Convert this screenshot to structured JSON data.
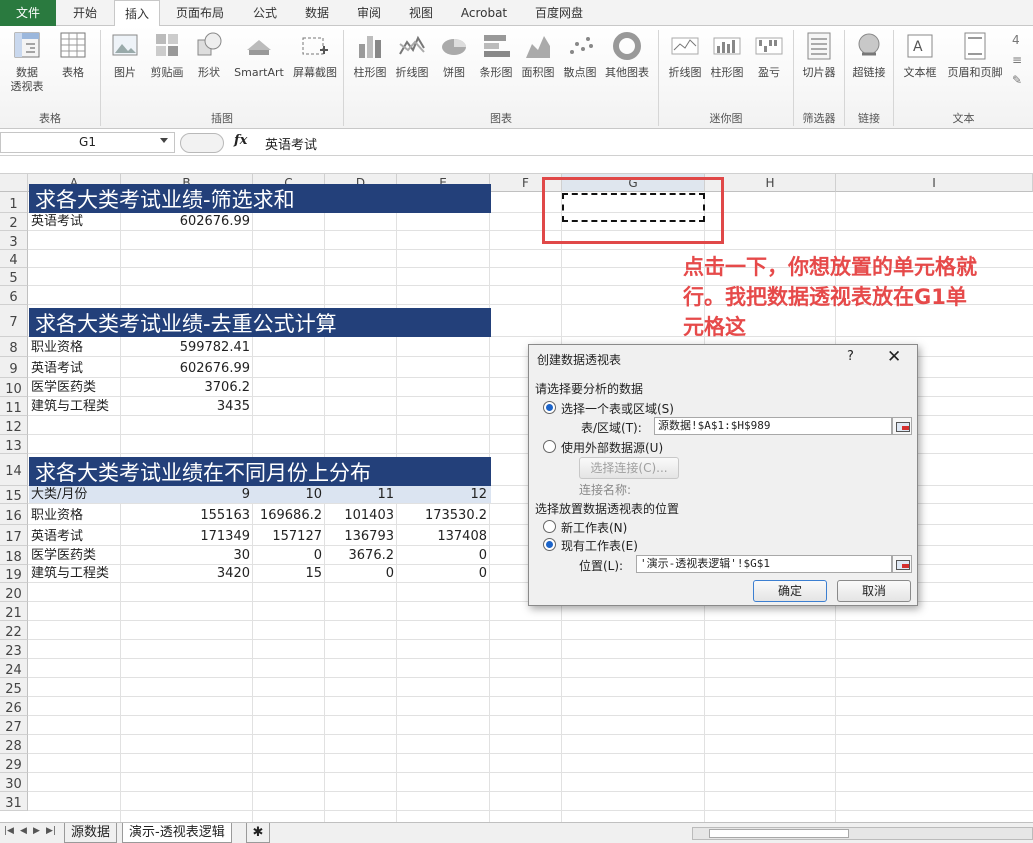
{
  "ribbon_tabs": [
    "文件",
    "开始",
    "插入",
    "页面布局",
    "公式",
    "数据",
    "审阅",
    "视图",
    "Acrobat",
    "百度网盘"
  ],
  "ribbon": {
    "buttons": [
      {
        "label": "数据",
        "label2": "透视表",
        "icon": "pivot-table-icon"
      },
      {
        "label": "表格",
        "label2": "",
        "icon": "table-icon"
      },
      {
        "label": "图片",
        "label2": "",
        "icon": "picture-icon"
      },
      {
        "label": "剪贴画",
        "label2": "",
        "icon": "clipart-icon"
      },
      {
        "label": "形状",
        "label2": "",
        "icon": "shapes-icon"
      },
      {
        "label": "SmartArt",
        "label2": "",
        "icon": "smartart-icon"
      },
      {
        "label": "屏幕截图",
        "label2": "",
        "icon": "screenshot-icon"
      },
      {
        "label": "柱形图",
        "label2": "",
        "icon": "column-chart-icon"
      },
      {
        "label": "折线图",
        "label2": "",
        "icon": "line-chart-icon"
      },
      {
        "label": "饼图",
        "label2": "",
        "icon": "pie-chart-icon"
      },
      {
        "label": "条形图",
        "label2": "",
        "icon": "bar-chart-icon"
      },
      {
        "label": "面积图",
        "label2": "",
        "icon": "area-chart-icon"
      },
      {
        "label": "散点图",
        "label2": "",
        "icon": "scatter-chart-icon"
      },
      {
        "label": "其他图表",
        "label2": "",
        "icon": "other-chart-icon"
      },
      {
        "label": "折线图",
        "label2": "",
        "icon": "sparkline-line-icon"
      },
      {
        "label": "柱形图",
        "label2": "",
        "icon": "sparkline-column-icon"
      },
      {
        "label": "盈亏",
        "label2": "",
        "icon": "sparkline-winloss-icon"
      },
      {
        "label": "切片器",
        "label2": "",
        "icon": "slicer-icon"
      },
      {
        "label": "超链接",
        "label2": "",
        "icon": "hyperlink-icon"
      },
      {
        "label": "文本框",
        "label2": "",
        "icon": "textbox-icon"
      },
      {
        "label": "页眉和页脚",
        "label2": "",
        "icon": "header-footer-icon"
      }
    ],
    "groups": [
      "表格",
      "插图",
      "图表",
      "迷你图",
      "筛选器",
      "链接",
      "文本"
    ]
  },
  "formula_bar": {
    "name_box": "G1",
    "fx": "fx",
    "content": "英语考试"
  },
  "columns": [
    "A",
    "B",
    "C",
    "D",
    "E",
    "F",
    "G",
    "H",
    "I"
  ],
  "rows": [
    "1",
    "2",
    "3",
    "4",
    "5",
    "6",
    "7",
    "8",
    "9",
    "10",
    "11",
    "12",
    "13",
    "14",
    "15",
    "16",
    "17",
    "18",
    "19",
    "20",
    "21",
    "22",
    "23",
    "24",
    "25",
    "26",
    "27",
    "28",
    "29",
    "30",
    "31"
  ],
  "sheet": {
    "section1": {
      "title": "求各大类考试业绩-筛选求和",
      "label": "英语考试",
      "value": "602676.99"
    },
    "section2": {
      "title": "求各大类考试业绩-去重公式计算",
      "rows": [
        {
          "label": "职业资格",
          "value": "599782.41"
        },
        {
          "label": "英语考试",
          "value": "602676.99"
        },
        {
          "label": "医学医药类",
          "value": "3706.2"
        },
        {
          "label": "建筑与工程类",
          "value": "3435"
        }
      ]
    },
    "section3": {
      "title": "求各大类考试业绩在不同月份上分布",
      "header": [
        "大类/月份",
        "9",
        "10",
        "11",
        "12"
      ],
      "rows": [
        [
          "职业资格",
          "155163",
          "169686.2",
          "101403",
          "173530.2"
        ],
        [
          "英语考试",
          "171349",
          "157127",
          "136793",
          "137408"
        ],
        [
          "医学医药类",
          "30",
          "0",
          "3676.2",
          "0"
        ],
        [
          "建筑与工程类",
          "3420",
          "15",
          "0",
          "0"
        ]
      ]
    }
  },
  "annotation": "点击一下，你想放置的单元格就行。我把数据透视表放在G1单元格这",
  "dialog": {
    "title": "创建数据透视表",
    "help": "?",
    "close": "✕",
    "section_analyze": "请选择要分析的数据",
    "opt_range": "选择一个表或区域(S)",
    "range_label": "表/区域(T):",
    "range_value": "源数据!$A$1:$H$989",
    "opt_external": "使用外部数据源(U)",
    "choose_conn": "选择连接(C)...",
    "conn_name": "连接名称:",
    "section_place": "选择放置数据透视表的位置",
    "opt_new": "新工作表(N)",
    "opt_existing": "现有工作表(E)",
    "location_label": "位置(L):",
    "location_value": "'演示-透视表逻辑'!$G$1",
    "ok": "确定",
    "cancel": "取消"
  },
  "sheet_tabs": [
    "源数据",
    "演示-透视表逻辑"
  ],
  "colors": {
    "title_bar": "#23407a",
    "header_band": "#dbe4f1",
    "annotation": "#e64a4a",
    "file_tab": "#2a7a3f"
  }
}
